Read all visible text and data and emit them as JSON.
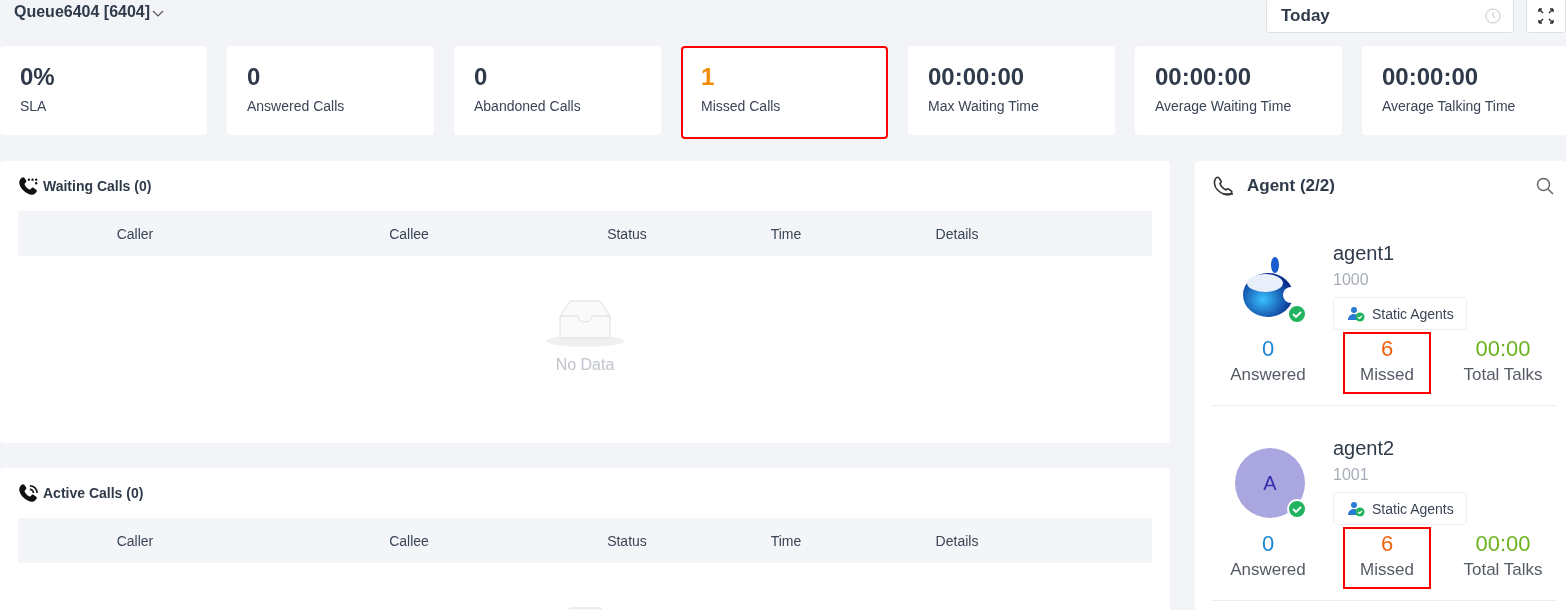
{
  "header": {
    "title": "Queue6404 [6404]",
    "date_field": {
      "value": "Today"
    }
  },
  "stat_cards": [
    {
      "value": "0%",
      "label": "SLA",
      "kind": "normal",
      "highlighted": false
    },
    {
      "value": "0",
      "label": "Answered Calls",
      "kind": "normal",
      "highlighted": false
    },
    {
      "value": "0",
      "label": "Abandoned Calls",
      "kind": "normal",
      "highlighted": false
    },
    {
      "value": "1",
      "label": "Missed Calls",
      "kind": "missed",
      "highlighted": true
    },
    {
      "value": "00:00:00",
      "label": "Max Waiting Time",
      "kind": "normal",
      "highlighted": false
    },
    {
      "value": "00:00:00",
      "label": "Average Waiting Time",
      "kind": "normal",
      "highlighted": false
    },
    {
      "value": "00:00:00",
      "label": "Average Talking Time",
      "kind": "normal",
      "highlighted": false
    }
  ],
  "panels": [
    {
      "title": "Waiting Calls (0)",
      "kind": "waiting",
      "columns": [
        "Caller",
        "Callee",
        "Status",
        "Time",
        "Details"
      ],
      "empty_text": "No Data"
    },
    {
      "title": "Active Calls (0)",
      "kind": "active",
      "columns": [
        "Caller",
        "Callee",
        "Status",
        "Time",
        "Details"
      ]
    }
  ],
  "agent_panel": {
    "title": "Agent (2/2)",
    "agents": [
      {
        "name": "agent1",
        "extension": "1000",
        "online": true,
        "tag": "Static Agents",
        "stats": [
          {
            "value": "0",
            "label": "Answered",
            "kind": "answered",
            "highlighted": false
          },
          {
            "value": "6",
            "label": "Missed",
            "kind": "missed",
            "highlighted": true
          },
          {
            "value": "00:00",
            "label": "Total Talks",
            "kind": "talks",
            "highlighted": false
          }
        ]
      },
      {
        "name": "agent2",
        "extension": "1001",
        "avatar": {
          "kind": "letter",
          "letter": "A"
        },
        "online": true,
        "tag": "Static Agents",
        "stats": [
          {
            "value": "0",
            "label": "Answered",
            "kind": "answered",
            "highlighted": false
          },
          {
            "value": "6",
            "label": "Missed",
            "kind": "missed",
            "highlighted": true
          },
          {
            "value": "00:00",
            "label": "Total Talks",
            "kind": "talks",
            "highlighted": false
          }
        ]
      }
    ]
  }
}
